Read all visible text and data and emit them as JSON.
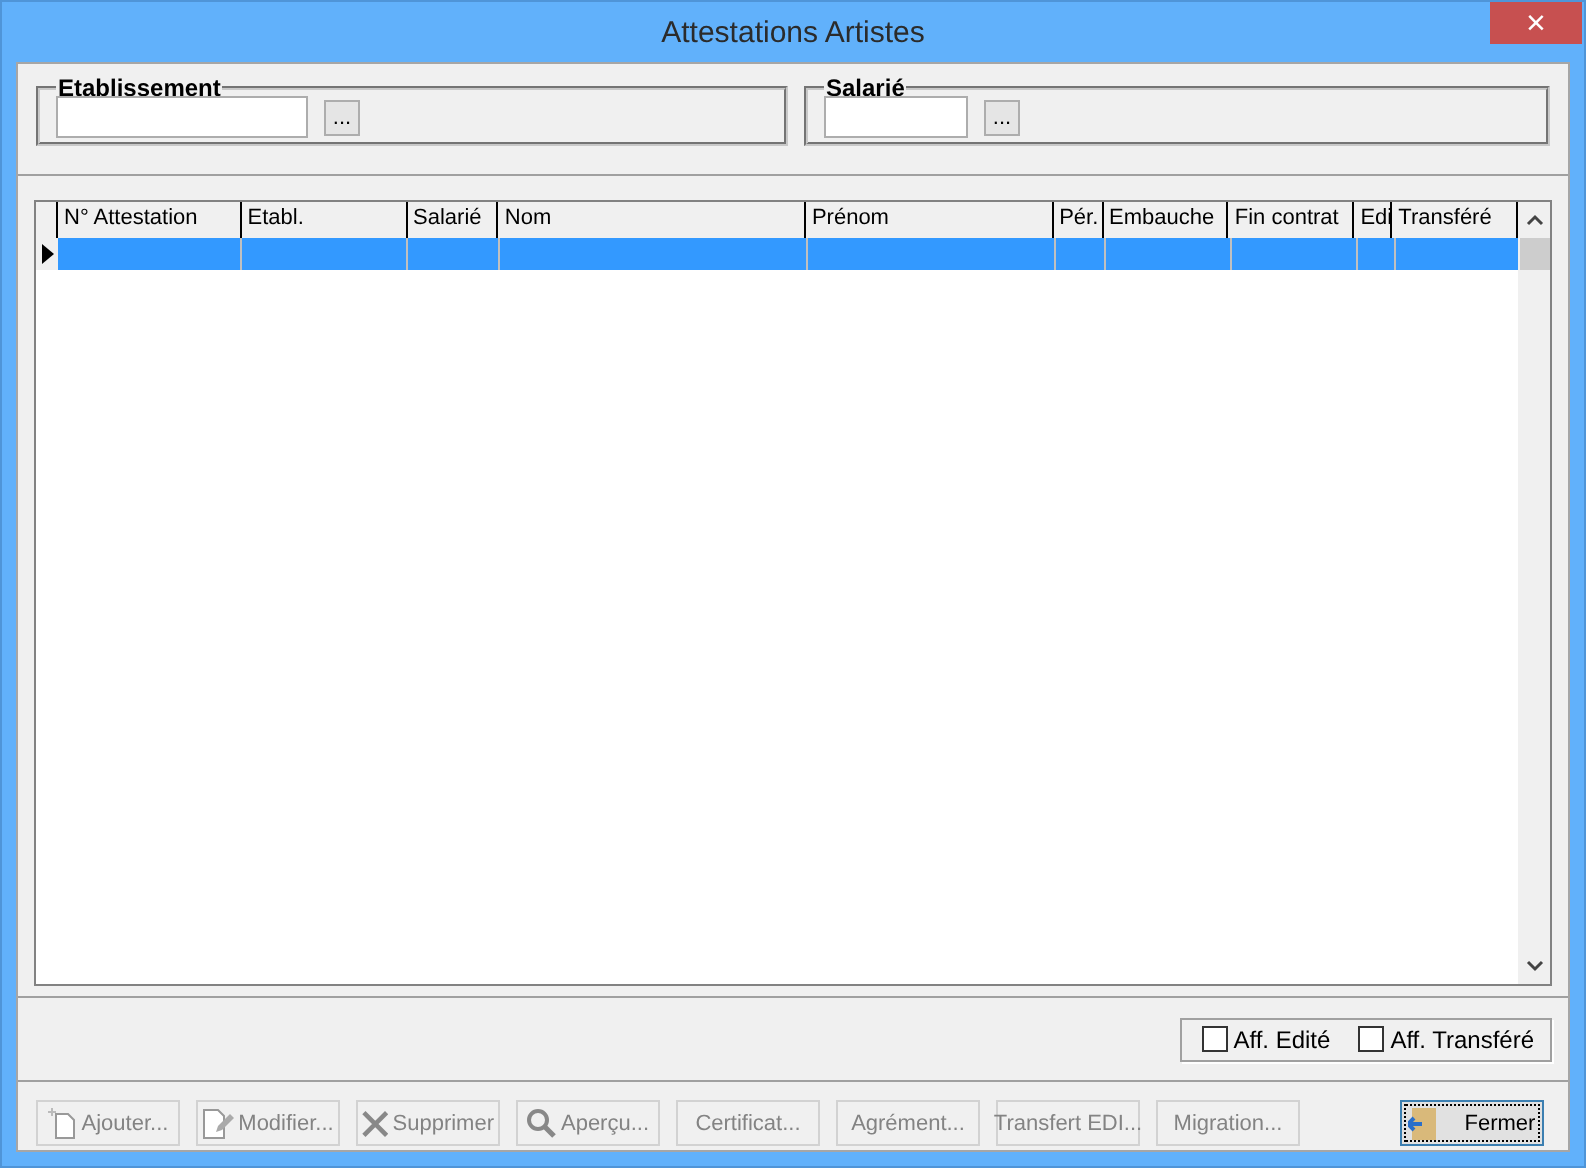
{
  "window": {
    "title": "Attestations Artistes",
    "close": "×"
  },
  "filters": [
    {
      "label": "Etablissement",
      "browse": "..."
    },
    {
      "label": "Salarié",
      "browse": "..."
    }
  ],
  "table": {
    "columns": [
      "N° Attestation",
      "Etabl.",
      "Salarié",
      "Nom",
      "Prénom",
      "Pér.",
      "Embauche",
      "Fin contrat",
      "Edi",
      "Transféré"
    ],
    "rows": [
      {
        "selected": true,
        "current": true
      }
    ]
  },
  "options": [
    {
      "label": "Aff. Edité",
      "checked": false
    },
    {
      "label": "Aff. Transféré",
      "checked": false
    }
  ],
  "buttons": [
    {
      "label": "Ajouter...",
      "kind": "new",
      "disabled": true
    },
    {
      "label": "Modifier...",
      "kind": "edit",
      "disabled": true
    },
    {
      "label": "Supprimer",
      "kind": "delete",
      "disabled": true
    },
    {
      "label": "Aperçu...",
      "kind": "search",
      "disabled": true
    },
    {
      "label": "Certificat...",
      "kind": "plain",
      "disabled": true
    },
    {
      "label": "Agrément...",
      "kind": "plain",
      "disabled": true
    },
    {
      "label": "Transfert EDI...",
      "kind": "plain",
      "disabled": true
    },
    {
      "label": "Migration...",
      "kind": "plain",
      "disabled": true
    },
    {
      "label": "Fermer",
      "kind": "exit",
      "disabled": false
    }
  ]
}
